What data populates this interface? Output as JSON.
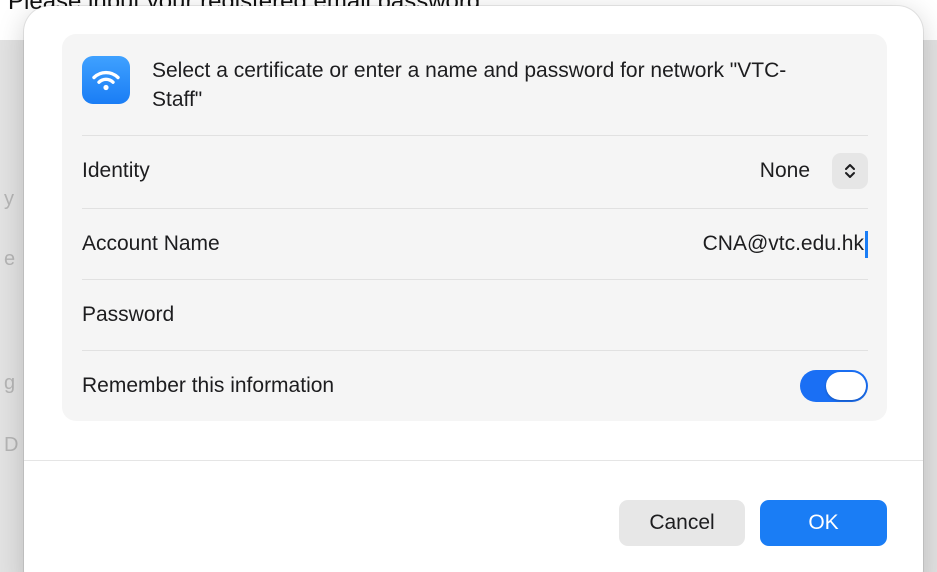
{
  "background": {
    "doc_text": "Please input your registered email password",
    "side_fragments": [
      "y",
      "e",
      "g",
      "D"
    ]
  },
  "dialog": {
    "network_icon": "wifi-icon",
    "message": "Select a certificate or enter a name and password for network \"VTC-Staff\"",
    "identity": {
      "label": "Identity",
      "value": "None",
      "control_icon": "chevron-up-down-icon"
    },
    "account": {
      "label": "Account Name",
      "value": "CNA@vtc.edu.hk"
    },
    "password": {
      "label": "Password",
      "value": ""
    },
    "remember": {
      "label": "Remember this information",
      "enabled": true
    },
    "buttons": {
      "cancel": "Cancel",
      "ok": "OK"
    }
  },
  "colors": {
    "accent": "#1a7df5",
    "toggle_on": "#1a6ff4",
    "card_bg": "#f5f5f5",
    "cancel_bg": "#e7e7e7"
  }
}
